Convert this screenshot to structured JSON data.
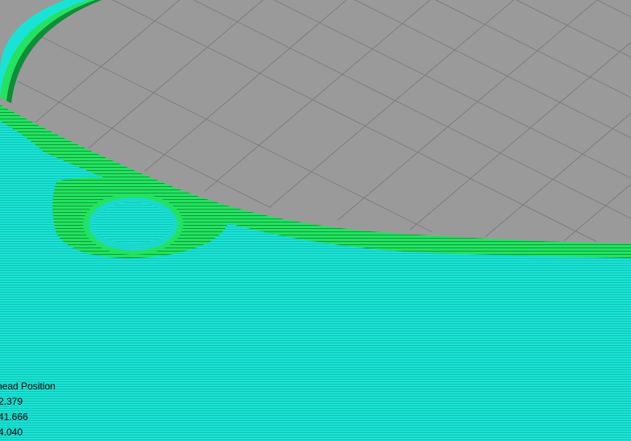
{
  "viewport": {
    "background_color": "#9a9a9a",
    "grid_line_color": "#7d7d7d",
    "wall_color": "#19e3d4",
    "wall_line_color": "#0fb5aa",
    "infill_color": "#1de05a",
    "infill_dark_color": "#0c8a34"
  },
  "readout": {
    "title": "head Position",
    "x": "2.379",
    "y": "41.666",
    "z": "4.040"
  }
}
